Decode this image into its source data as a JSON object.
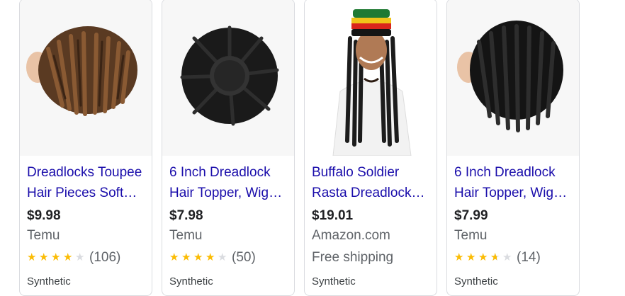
{
  "products": [
    {
      "title": "Dreadlocks Toupee Hair Pieces Soft…",
      "price": "$9.98",
      "merchant": "Temu",
      "rating": 4,
      "rating_count": "(106)",
      "attribute": "Synthetic",
      "image_icon": "dreadlock-toupee-brown-image"
    },
    {
      "title": "6 Inch Dreadlock Hair Topper, Wig…",
      "price": "$7.98",
      "merchant": "Temu",
      "rating": 4,
      "rating_count": "(50)",
      "attribute": "Synthetic",
      "image_icon": "dreadlock-topper-black-image"
    },
    {
      "title": "Buffalo Soldier Rasta Dreadlock…",
      "price": "$19.01",
      "merchant": "Amazon.com",
      "shipping": "Free shipping",
      "attribute": "Synthetic",
      "image_icon": "rasta-hat-wig-model-image"
    },
    {
      "title": "6 Inch Dreadlock Hair Topper, Wig…",
      "price": "$7.99",
      "merchant": "Temu",
      "rating": 3.5,
      "rating_count": "(14)",
      "attribute": "Synthetic",
      "image_icon": "dreadlock-topper-black-image"
    }
  ],
  "colors": {
    "title_link": "#1a0dab",
    "star_filled": "#fbbc04",
    "star_empty": "#dadce0",
    "merchant_text": "#5f6368"
  }
}
